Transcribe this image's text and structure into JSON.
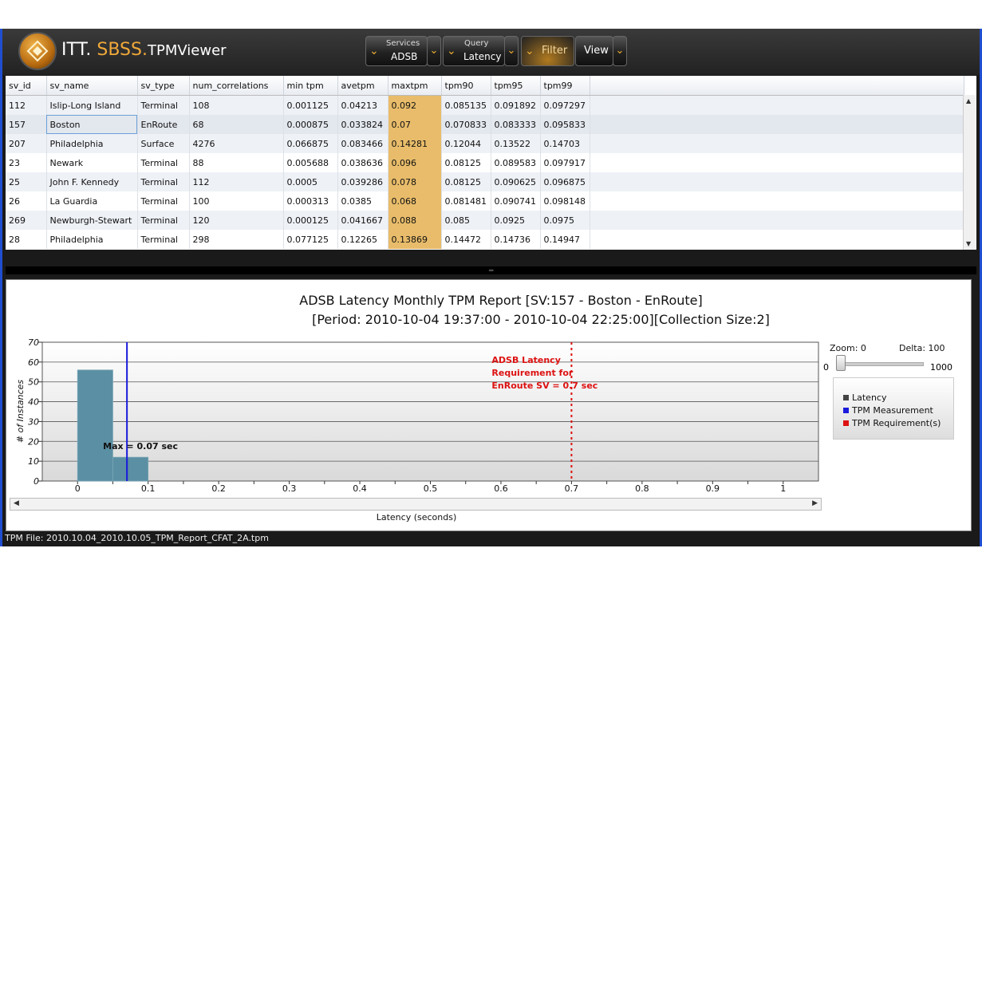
{
  "app": {
    "brand_itt": "ITT.",
    "brand_sbss": "SBSS.",
    "brand_name": "TPMViewer"
  },
  "toolbar": {
    "services_caption": "Services",
    "services_value": "ADSB",
    "query_caption": "Query",
    "query_value": "Latency",
    "filter_label": "Filter",
    "view_label": "View"
  },
  "grid": {
    "columns": [
      "sv_id",
      "sv_name",
      "sv_type",
      "num_correlations",
      "min tpm",
      "avetpm",
      "maxtpm",
      "tpm90",
      "tpm95",
      "tpm99"
    ],
    "rows": [
      [
        "112",
        "Islip-Long Island",
        "Terminal",
        "108",
        "0.001125",
        "0.04213",
        "0.092",
        "0.085135",
        "0.091892",
        "0.097297"
      ],
      [
        "157",
        "Boston",
        "EnRoute",
        "68",
        "0.000875",
        "0.033824",
        "0.07",
        "0.070833",
        "0.083333",
        "0.095833"
      ],
      [
        "207",
        "Philadelphia",
        "Surface",
        "4276",
        "0.066875",
        "0.083466",
        "0.14281",
        "0.12044",
        "0.13522",
        "0.14703"
      ],
      [
        "23",
        "Newark",
        "Terminal",
        "88",
        "0.005688",
        "0.038636",
        "0.096",
        "0.08125",
        "0.089583",
        "0.097917"
      ],
      [
        "25",
        "John F. Kennedy",
        "Terminal",
        "112",
        "0.0005",
        "0.039286",
        "0.078",
        "0.08125",
        "0.090625",
        "0.096875"
      ],
      [
        "26",
        "La Guardia",
        "Terminal",
        "100",
        "0.000313",
        "0.0385",
        "0.068",
        "0.081481",
        "0.090741",
        "0.098148"
      ],
      [
        "269",
        "Newburgh-Stewart",
        "Terminal",
        "120",
        "0.000125",
        "0.041667",
        "0.088",
        "0.085",
        "0.0925",
        "0.0975"
      ],
      [
        "28",
        "Philadelphia",
        "Terminal",
        "298",
        "0.077125",
        "0.12265",
        "0.13869",
        "0.14472",
        "0.14736",
        "0.14947"
      ]
    ]
  },
  "chart_data": {
    "type": "bar",
    "title": "ADSB  Latency Monthly TPM Report  [SV:157 - Boston - EnRoute]",
    "subtitle": "[Period: 2010-10-04 19:37:00 - 2010-10-04 22:25:00][Collection Size:2]",
    "xlabel": "Latency (seconds)",
    "ylabel": "# of Instances",
    "xlim": [
      -0.05,
      1.05
    ],
    "ylim": [
      0,
      70
    ],
    "xticks": [
      "0",
      "0.1",
      "0.2",
      "0.3",
      "0.4",
      "0.5",
      "0.6",
      "0.7",
      "0.8",
      "0.9",
      "1"
    ],
    "yticks": [
      "0",
      "10",
      "20",
      "30",
      "40",
      "50",
      "60",
      "70"
    ],
    "bins": [
      {
        "x_start": 0,
        "x_end": 0.05,
        "value": 56
      },
      {
        "x_start": 0.05,
        "x_end": 0.1,
        "value": 12
      }
    ],
    "measurement_x": 0.07,
    "measurement_label": "Max = 0.07 sec",
    "requirement_x": 0.7,
    "requirement_label": [
      "ADSB Latency",
      "Requirement for",
      "EnRoute SV = 0.7 sec"
    ],
    "colors": {
      "bar": "#5b8fa3",
      "measurement": "#1a1adc",
      "requirement": "#dd1111"
    },
    "legend": [
      "Latency",
      "TPM Measurement",
      "TPM Requirement(s)"
    ],
    "legend_colors": [
      "#444444",
      "#1a1adc",
      "#dd1111"
    ],
    "legend_position": "right",
    "grid": true
  },
  "controls": {
    "zoom_label": "Zoom: 0",
    "delta_label": "Delta: 100",
    "slider_min": "0",
    "slider_max": "1000",
    "slider_value": 0
  },
  "status": {
    "file": "TPM File: 2010.10.04_2010.10.05_TPM_Report_CFAT_2A.tpm"
  }
}
